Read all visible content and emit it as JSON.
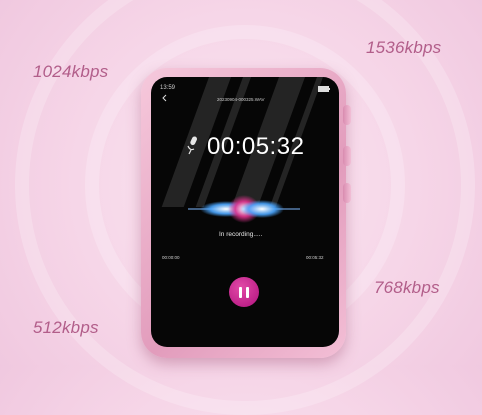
{
  "bitrates": {
    "top_left": "1024kbps",
    "top_right": "1536kbps",
    "bottom_right": "768kbps",
    "bottom_left": "512kbps"
  },
  "screen": {
    "clock": "13:59",
    "filename": "20230904-000325.WAV",
    "timer": "00:05:32",
    "status": "In recording.....",
    "elapsed": "00:00:00",
    "total": "00:05:32"
  },
  "colors": {
    "device": "#e7a6c4",
    "accent": "#c21a8a",
    "label": "#b25e8a"
  },
  "icons": [
    "back-icon",
    "battery-icon",
    "microphone-icon",
    "pause-icon"
  ]
}
